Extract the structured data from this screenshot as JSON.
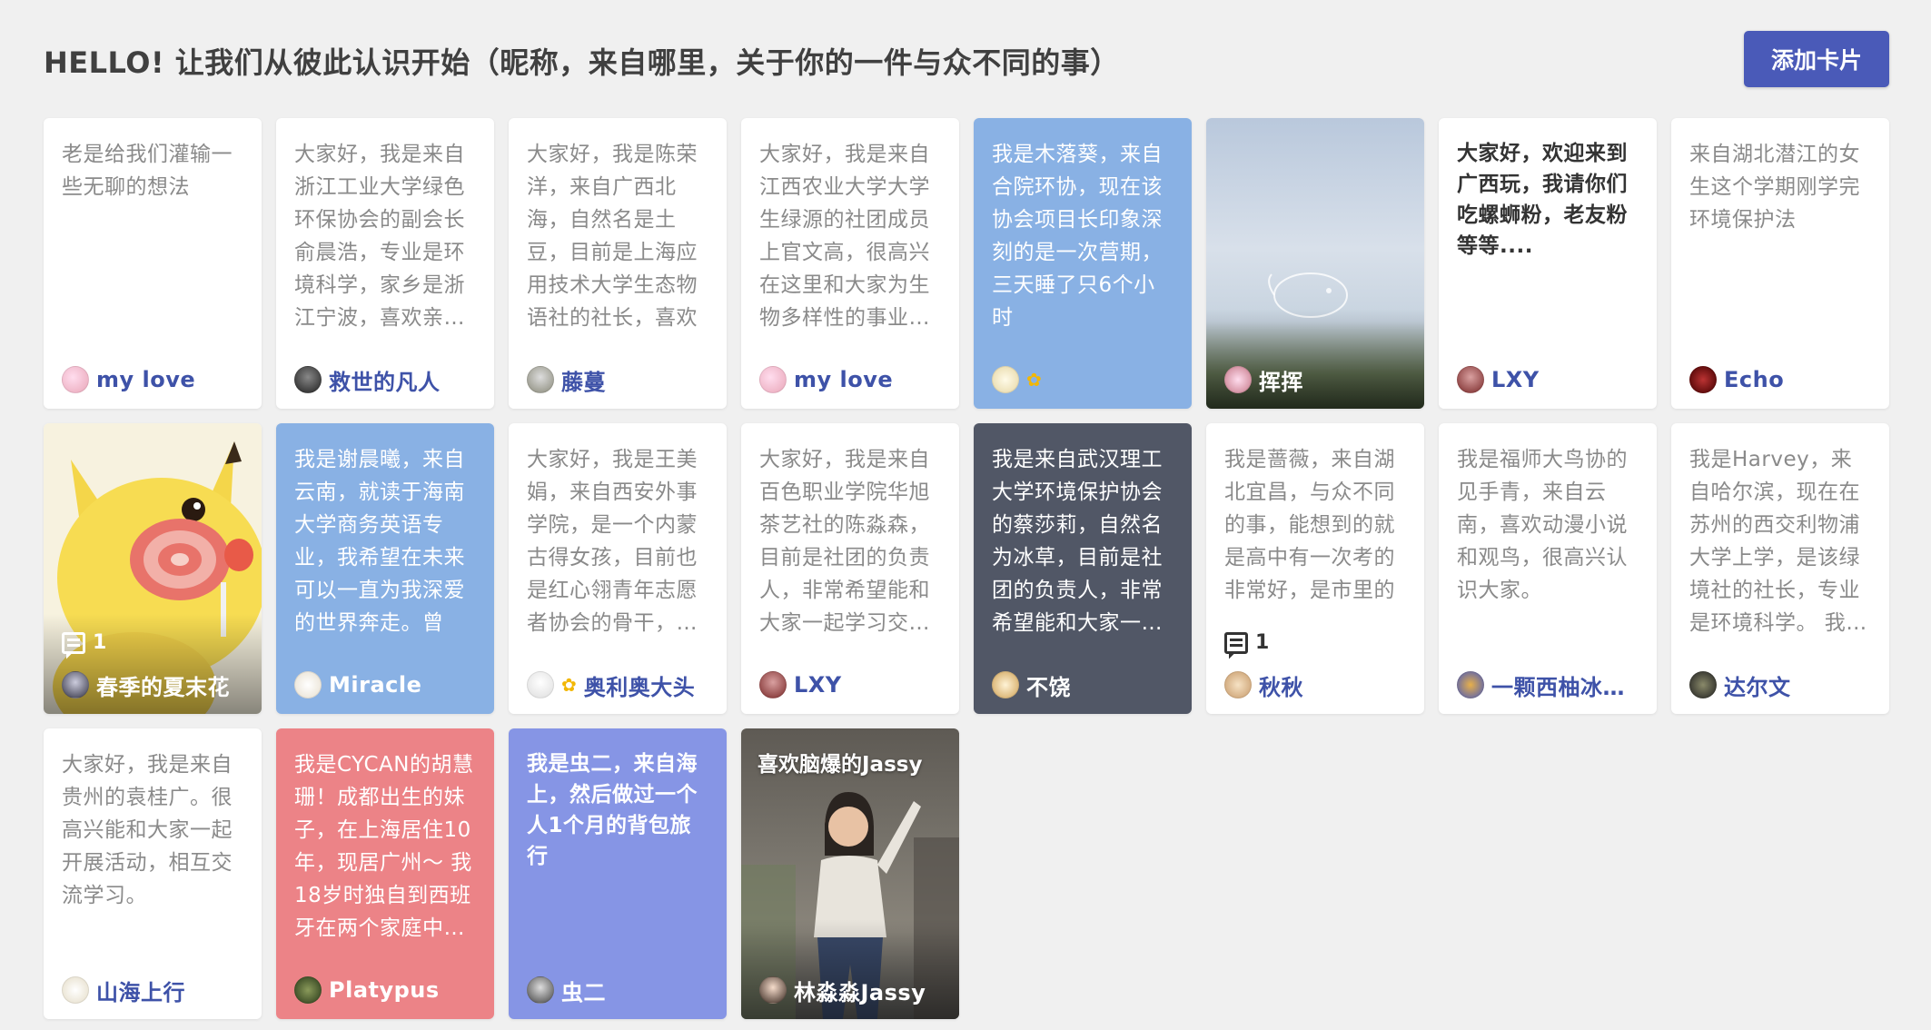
{
  "header": {
    "title": "HELLO! 让我们从彼此认识开始（昵称，来自哪里，关于你的一件与众不同的事）",
    "add_button_label": "添加卡片"
  },
  "cards": [
    {
      "text": "老是给我们灌输一些无聊的想法",
      "author": "my love",
      "style": "white"
    },
    {
      "text": "大家好，我是来自浙江工业大学绿色环保协会的副会长俞晨浩，专业是环境科学，家乡是浙江宁波，喜欢亲…",
      "author": "救世的凡人",
      "style": "white"
    },
    {
      "text": "大家好，我是陈荣洋，来自广西北海，自然名是土豆，目前是上海应用技术大学生态物语社的社长，喜欢养…",
      "author": "藤蔓",
      "style": "white"
    },
    {
      "text": "大家好，我是来自江西农业大学大学生绿源的社团成员上官文高，很高兴在这里和大家为生物多样性的事业…",
      "author": "my love",
      "style": "white"
    },
    {
      "text": "我是木落葵，来自合院环协，现在该协会项目长印象深刻的是一次营期，三天睡了只6个小时",
      "author": "",
      "style": "blue",
      "sun": true
    },
    {
      "text": "",
      "author": "挥挥",
      "style": "sky"
    },
    {
      "text": "大家好，欢迎来到广西玩，我请你们吃螺蛳粉，老友粉等等....",
      "author": "LXY",
      "style": "white-bold"
    },
    {
      "text": "来自湖北潜江的女生这个学期刚学完环境保护法",
      "author": "Echo",
      "style": "white"
    },
    {
      "text": "",
      "author": "春季的夏末花",
      "style": "pikachu",
      "comments": "1"
    },
    {
      "text": "我是谢晨曦，来自云南，就读于海南大学商务英语专业，我希望在未来可以一直为我深爱的世界奔走。曾经…",
      "author": "Miracle",
      "style": "blue"
    },
    {
      "text": "大家好，我是王美娟，来自西安外事学院，是一个内蒙古得女孩，目前也是红心翎青年志愿者协会的骨干，…",
      "author": "奥利奥大头",
      "style": "white",
      "sun": true
    },
    {
      "text": "大家好，我是来自百色职业学院华旭茶艺社的陈淼森，目前是社团的负责人，非常希望能和大家一起学习交…",
      "author": "LXY",
      "style": "white"
    },
    {
      "text": "我是来自武汉理工大学环境保护协会的蔡莎莉，自然名为冰草，目前是社团的负责人，非常希望能和大家一…",
      "author": "不饶",
      "style": "dark"
    },
    {
      "text": "我是蔷薇，来自湖北宜昌，与众不同的事，能想到的就是高中有一次考的非常好，是市里的",
      "author": "秋秋",
      "style": "white",
      "comments": "1"
    },
    {
      "text": "我是福师大鸟协的见手青，来自云南，喜欢动漫小说和观鸟，很高兴认识大家。",
      "author": "一颗西柚冰…",
      "style": "white"
    },
    {
      "text": "我是Harvey，来自哈尔滨，现在在苏州的西交利物浦大学上学，是该绿境社的社长，专业是环境科学。 我…",
      "author": "达尔文",
      "style": "white"
    },
    {
      "text": "大家好，我是来自贵州的袁桂广。很高兴能和大家一起开展活动，相互交流学习。",
      "author": "山海上行",
      "style": "white"
    },
    {
      "text": "我是CYCAN的胡慧珊！成都出生的妹子，在上海居住10年，现居广州～ 我18岁时独自到西班牙在两个家庭中…",
      "author": "Platypus",
      "style": "red"
    },
    {
      "text": "我是虫二，来自海上，然后做过一个人1个月的背包旅行",
      "author": "虫二",
      "style": "purple-bold"
    },
    {
      "text": "喜欢脑爆的Jassy",
      "author": "林淼淼Jassy",
      "style": "person"
    }
  ]
}
